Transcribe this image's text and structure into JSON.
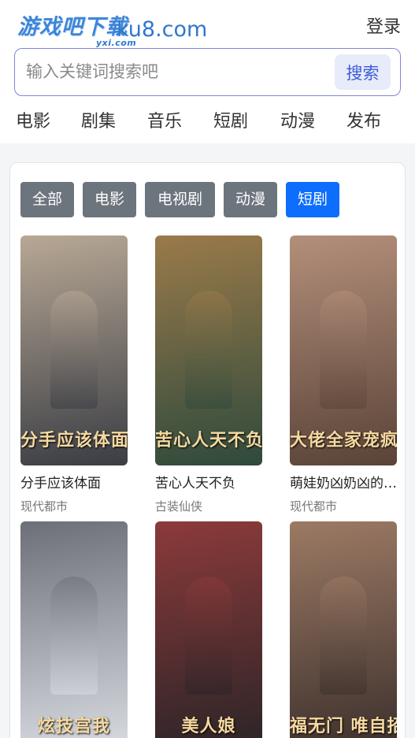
{
  "header": {
    "logo_text": "游戏吧下载",
    "logo_subtext": "yxi.com",
    "domain": "ku8.com",
    "login_label": "登录"
  },
  "search": {
    "placeholder": "输入关键词搜索吧",
    "button_label": "搜索"
  },
  "nav": [
    "电影",
    "剧集",
    "音乐",
    "短剧",
    "动漫",
    "发布"
  ],
  "filters": [
    {
      "label": "全部",
      "active": false
    },
    {
      "label": "电影",
      "active": false
    },
    {
      "label": "电视剧",
      "active": false
    },
    {
      "label": "动漫",
      "active": false
    },
    {
      "label": "短剧",
      "active": true
    }
  ],
  "items": [
    {
      "title": "分手应该体面",
      "genre": "现代都市",
      "poster_text": "分手应该体面",
      "colors": [
        "#3a3d44",
        "#b8a895"
      ]
    },
    {
      "title": "苦心人天不负",
      "genre": "古装仙侠",
      "poster_text": "苦心人天不负",
      "colors": [
        "#2f4a3c",
        "#9a7a4a"
      ]
    },
    {
      "title": "萌娃奶凶奶凶的大佬全家宠疯了",
      "genre": "现代都市",
      "poster_text": "大佬全家宠疯",
      "colors": [
        "#5a4338",
        "#b38f7a"
      ]
    },
    {
      "title": "",
      "genre": "",
      "poster_text": "炫技宫我",
      "colors": [
        "#d9dde3",
        "#6d6f78"
      ]
    },
    {
      "title": "",
      "genre": "",
      "poster_text": "美人娘",
      "colors": [
        "#2a2427",
        "#8c3a3a"
      ]
    },
    {
      "title": "",
      "genre": "",
      "poster_text": "福无门 唯自招",
      "colors": [
        "#3b2f2c",
        "#9c7a64"
      ]
    }
  ],
  "colors": {
    "accent": "#0d6efd",
    "filter_default": "#6c757d",
    "search_border": "#7e86d8",
    "logo_blue": "#3d86d8"
  }
}
